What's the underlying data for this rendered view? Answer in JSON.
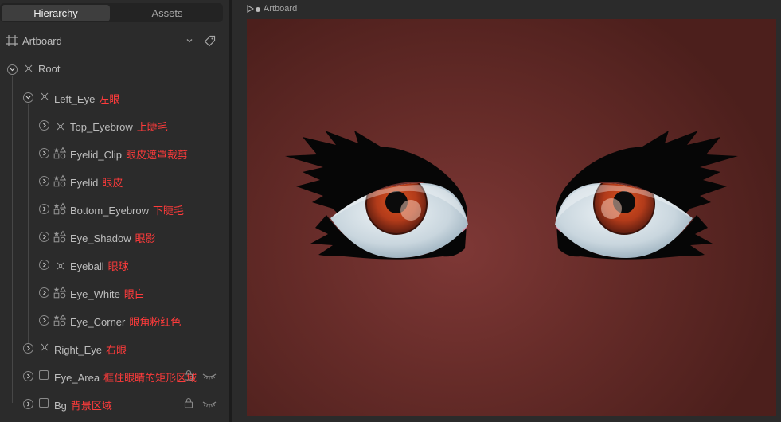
{
  "tabs": {
    "hierarchy": "Hierarchy",
    "assets": "Assets"
  },
  "artboard": {
    "label": "Artboard"
  },
  "tree": {
    "root": {
      "name": "Root"
    },
    "left_eye": {
      "name": "Left_Eye",
      "note": "左眼"
    },
    "children": [
      {
        "name": "Top_Eyebrow",
        "note": "上睫毛",
        "icon": "group-icon"
      },
      {
        "name": "Eyelid_Clip",
        "note": "眼皮遮罩裁剪",
        "icon": "shapes-icon"
      },
      {
        "name": "Eyelid",
        "note": "眼皮",
        "icon": "shapes-icon"
      },
      {
        "name": "Bottom_Eyebrow",
        "note": "下睫毛",
        "icon": "shapes-icon"
      },
      {
        "name": "Eye_Shadow",
        "note": "眼影",
        "icon": "shapes-icon"
      },
      {
        "name": "Eyeball",
        "note": "眼球",
        "icon": "group-icon"
      },
      {
        "name": "Eye_White",
        "note": "眼白",
        "icon": "shapes-icon"
      },
      {
        "name": "Eye_Corner",
        "note": "眼角粉红色",
        "icon": "shapes-icon"
      }
    ],
    "right_eye": {
      "name": "Right_Eye",
      "note": "右眼"
    },
    "eye_area": {
      "name": "Eye_Area",
      "note": "框住眼睛的矩形区域"
    },
    "bg": {
      "name": "Bg",
      "note": "背景区域"
    }
  },
  "breadcrumb": {
    "label": "Artboard"
  },
  "colors": {
    "annotation": "#ff3b3b",
    "panel": "#2b2b2b",
    "canvas_bg": "#6e302d",
    "iris": "#c44a1e"
  }
}
